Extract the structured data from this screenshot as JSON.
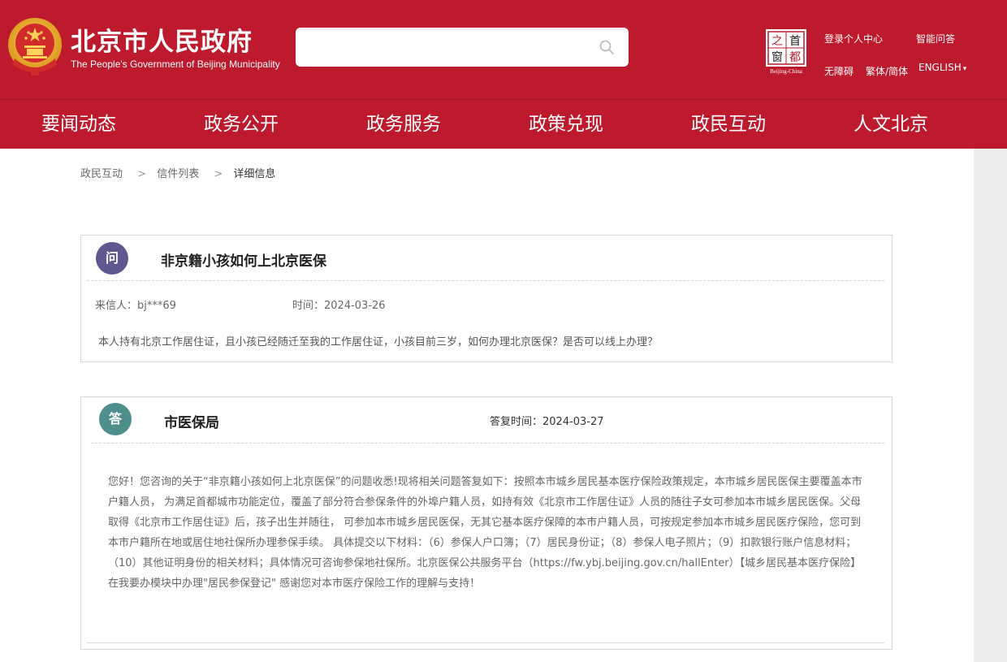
{
  "header": {
    "title_cn": "北京市人民政府",
    "title_en": "The People's Government of Beijing Municipality",
    "search_placeholder": "",
    "capital_logo": {
      "chars": [
        "之",
        "首",
        "窗",
        "都"
      ],
      "caption": "Beijing-China"
    },
    "links": {
      "login": "登录个人中心",
      "ai_qa": "智能问答",
      "accessibility": "无障碍",
      "traditional_simplified": "繁体/简体",
      "english": "ENGLISH",
      "english_arrow": "▾"
    }
  },
  "nav": {
    "items": [
      {
        "label": "要闻动态"
      },
      {
        "label": "政务公开"
      },
      {
        "label": "政务服务"
      },
      {
        "label": "政策兑现"
      },
      {
        "label": "政民互动"
      },
      {
        "label": "人文北京"
      }
    ]
  },
  "breadcrumb": {
    "items": [
      "政民互动",
      "信件列表",
      "详细信息"
    ],
    "separator": ">"
  },
  "question": {
    "badge": "问",
    "title": "非京籍小孩如何上北京医保",
    "sender": "来信人：bj***69",
    "time": "时间：2024-03-26",
    "content": "本人持有北京工作居住证，且小孩已经随迁至我的工作居住证，小孩目前三岁，如何办理北京医保？是否可以线上办理？"
  },
  "answer": {
    "badge": "答",
    "department": "市医保局",
    "reply_time": "答复时间：2024-03-27",
    "content": "您好！您咨询的关于“非京籍小孩如何上北京医保”的问题收悉!现将相关问题答复如下：按照本市城乡居民基本医疗保险政策规定，本市城乡居民医保主要覆盖本市户籍人员， 为满足首都城市功能定位，覆盖了部分符合参保条件的外埠户籍人员，如持有效《北京市工作居住证》人员的随往子女可参加本市城乡居民医保。父母取得《北京市工作居住证》后，孩子出生并随往， 可参加本市城乡居民医保，无其它基本医疗保障的本市户籍人员，可按规定参加本市城乡居民医疗保险，您可到本市户籍所在地或居住地社保所办理参保手续。 具体提交以下材料：（6）参保人户口簿；（7）居民身份证；（8）参保人电子照片；（9）扣款银行账户信息材料；（10）其他证明身份的相关材料；具体情况可咨询参保地社保所。北京医保公共服务平台（https://fw.ybj.beijing.gov.cn/hallEnter）【城乡居民基本医疗保险】 在我要办模块中办理\"居民参保登记\" 感谢您对本市医疗保险工作的理解与支持！"
  },
  "colors": {
    "brand_red": "#bd1a2d",
    "question_badge": "#5f578f",
    "answer_badge": "#4e8f8c"
  }
}
